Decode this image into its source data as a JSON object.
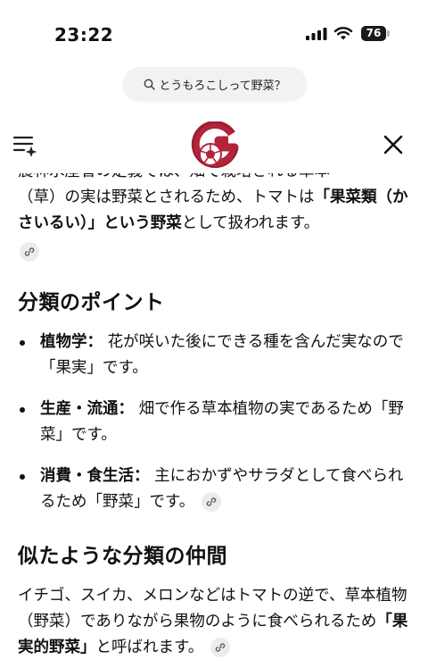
{
  "status_bar": {
    "time": "23:22",
    "battery": "76"
  },
  "search": {
    "query": "とうもろこしって野菜？"
  },
  "header": {},
  "content": {
    "intro_line_cutoff": "農林水産省の定義では、畑で栽培される草本",
    "intro_p1": "（草）の実は野菜とされるため、トマトは",
    "intro_b1": "「果菜類（かさいるい）」という野菜",
    "intro_p2": "として扱われます。",
    "section1_heading": "分類のポイント",
    "bullets": [
      {
        "term": "植物学：",
        "text": "花が咲いた後にできる種を含んだ実なので「果実」です。"
      },
      {
        "term": "生産・流通：",
        "text": "畑で作る草本植物の実であるため「野菜」です。"
      },
      {
        "term": "消費・食生活：",
        "text": "主におかずやサラダとして食べられるため「野菜」です。"
      }
    ],
    "section2_heading": "似たような分類の仲間",
    "outro_p1": "イチゴ、スイカ、メロンなどはトマトの逆で、草本植物（野菜）でありながら果物のように食べられるため",
    "outro_b1": "「果実的野菜」",
    "outro_p2": "と呼ばれます。"
  }
}
